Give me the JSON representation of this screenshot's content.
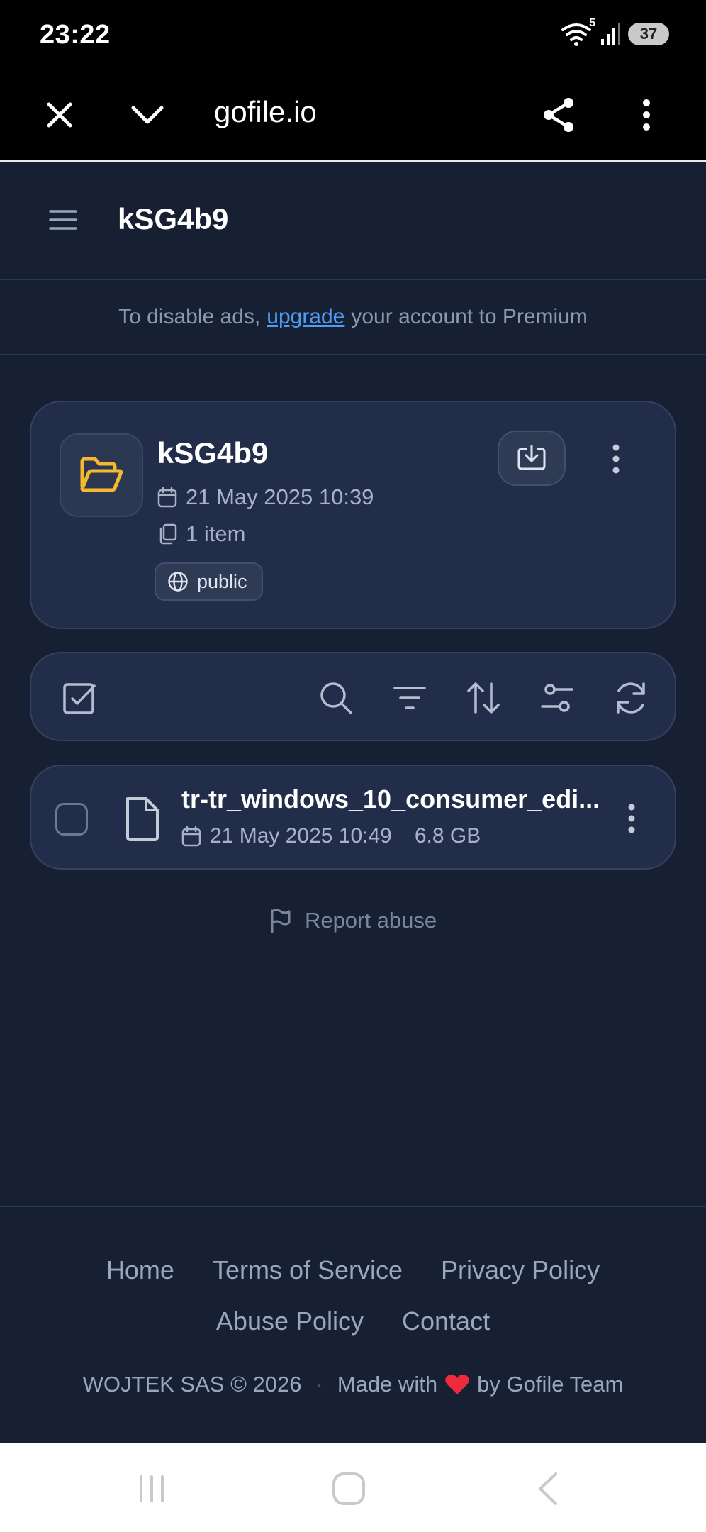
{
  "status_bar": {
    "time": "23:22",
    "wifi_badge": "5",
    "battery": "37"
  },
  "browser": {
    "url": "gofile.io",
    "icons": [
      "close-icon",
      "chevron-down-icon",
      "share-icon",
      "more-vertical-icon"
    ]
  },
  "header": {
    "title": "kSG4b9",
    "menu_icon": "hamburger-icon"
  },
  "ad_banner": {
    "prefix": "To disable ads,",
    "link": "upgrade",
    "suffix": "your account to Premium",
    "link_color": "#4f9cf7"
  },
  "folder": {
    "name": "kSG4b9",
    "date": "21 May 2025 10:39",
    "items": "1 item",
    "visibility": "public",
    "accent_color": "#f5b82e"
  },
  "toolbar": {
    "icons": [
      "select-all-icon",
      "search-icon",
      "filter-icon",
      "sort-icon",
      "settings-sliders-icon",
      "refresh-icon"
    ]
  },
  "files": [
    {
      "name": "tr-tr_windows_10_consumer_edi...",
      "date": "21 May 2025 10:49",
      "size": "6.8 GB"
    }
  ],
  "report": {
    "label": "Report abuse"
  },
  "footer": {
    "links_row1": [
      "Home",
      "Terms of Service",
      "Privacy Policy"
    ],
    "links_row2": [
      "Abuse Policy",
      "Contact"
    ],
    "copyright": "WOJTEK SAS © 2026",
    "separator": "·",
    "made_with": "Made with",
    "by": "by Gofile Team",
    "heart_color": "#ef2a3a"
  }
}
